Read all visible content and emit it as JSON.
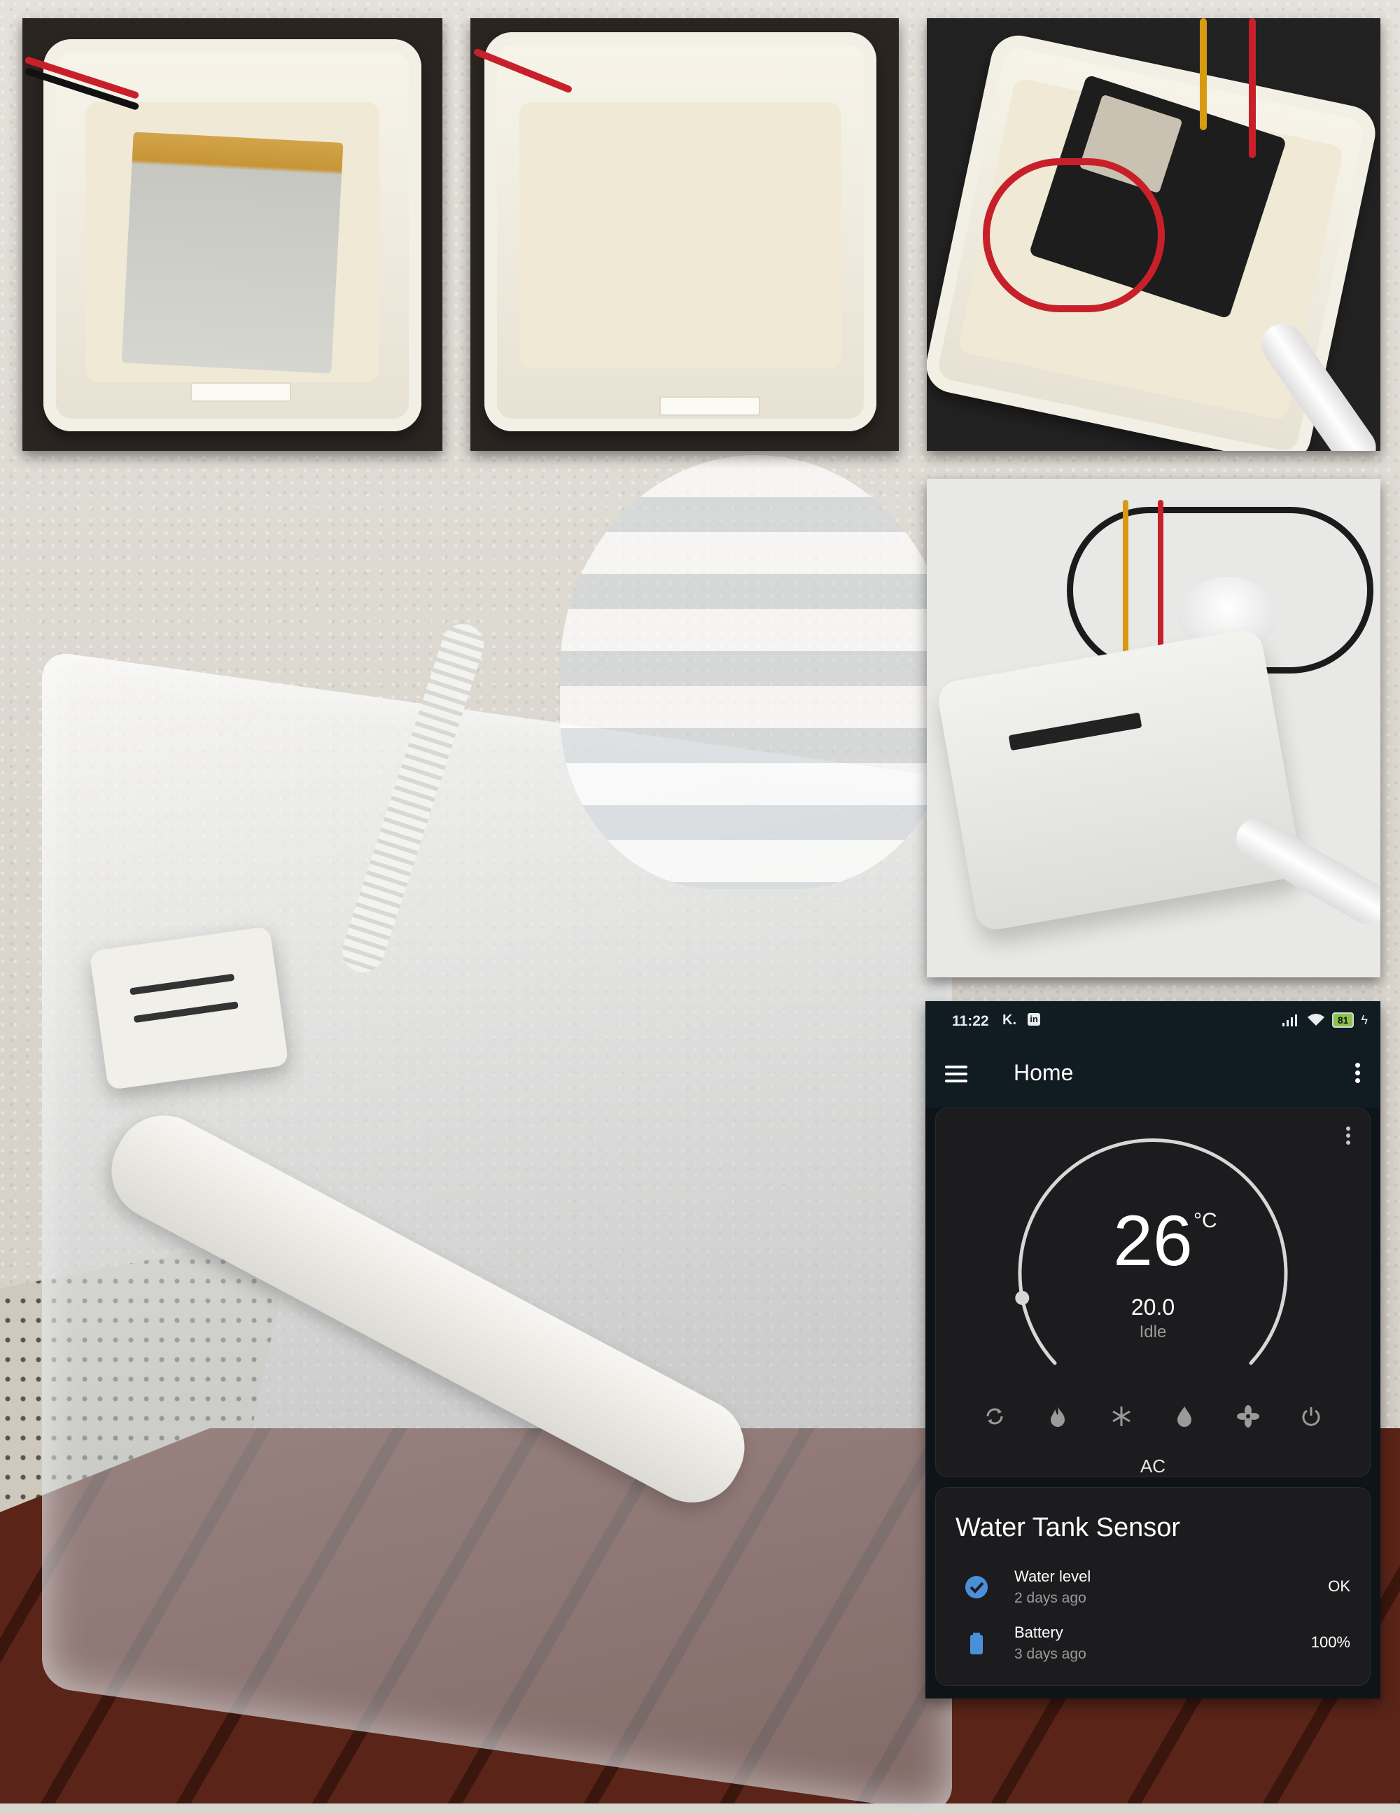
{
  "status_bar": {
    "time": "11:22",
    "notification_icons": [
      "k-icon",
      "linkedin-icon"
    ],
    "battery_level": "81",
    "icons": [
      "signal-icon",
      "wifi-icon",
      "battery-icon",
      "charging-icon"
    ]
  },
  "app_bar": {
    "title": "Home"
  },
  "thermostat": {
    "current_temperature": "26",
    "unit": "°C",
    "target_temperature": "20.0",
    "state": "Idle",
    "hvac_mode": "AC",
    "modes": [
      "auto-mode-icon",
      "heat-mode-icon",
      "cool-mode-icon",
      "dry-mode-icon",
      "fan-mode-icon",
      "power-icon"
    ],
    "slider_fraction": 0.12
  },
  "sensor_card": {
    "title": "Water Tank Sensor",
    "entities": [
      {
        "name": "Water level",
        "last_changed": "2 days ago",
        "state": "OK",
        "icon": "check-circle-icon"
      },
      {
        "name": "Battery",
        "last_changed": "3 days ago",
        "state": "100%",
        "icon": "battery-full-icon"
      }
    ]
  },
  "colors": {
    "app_background": "#0f1419",
    "card_background": "#1c1c1e",
    "accent_blue": "#4a90d9",
    "battery_badge": "#8bc34a"
  }
}
